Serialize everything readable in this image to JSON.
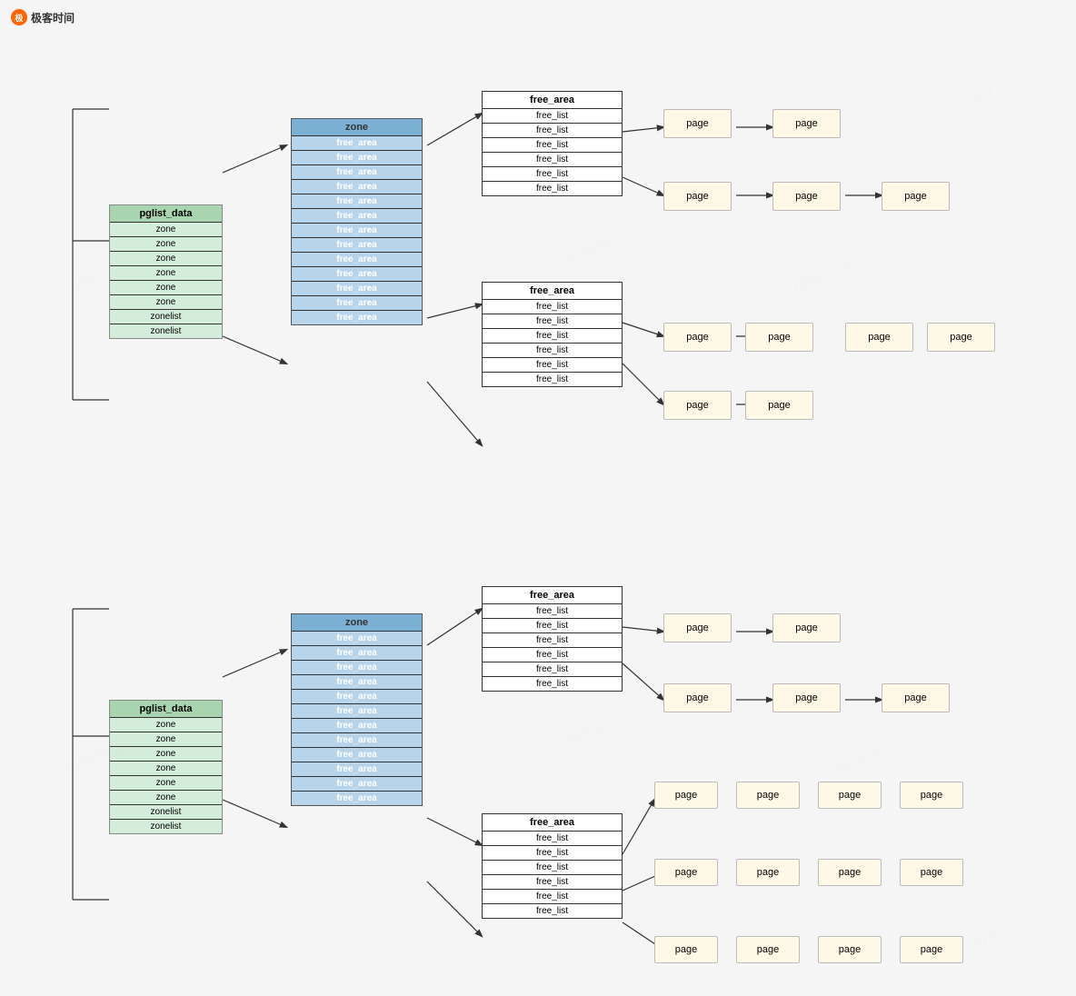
{
  "logo": {
    "icon": "极",
    "text": "极客时间"
  },
  "diagram": {
    "section1": {
      "pglist": {
        "label": "pglist_data",
        "rows": [
          "zone",
          "zone",
          "zone",
          "zone",
          "zone",
          "zone",
          "zonelist",
          "zonelist"
        ]
      },
      "zone": {
        "label": "zone",
        "rows": [
          "free_area",
          "free_area",
          "free_area",
          "free_area",
          "free_area",
          "free_area",
          "free_area",
          "free_area",
          "free_area",
          "free_area",
          "free_area",
          "free_area",
          "free_area"
        ]
      },
      "freeArea1": {
        "label": "free_area",
        "rows": [
          "free_list",
          "free_list",
          "free_list",
          "free_list",
          "free_list",
          "free_list"
        ]
      },
      "freeArea2": {
        "label": "free_area",
        "rows": [
          "free_list",
          "free_list",
          "free_list",
          "free_list",
          "free_list",
          "free_list"
        ]
      }
    },
    "section2": {
      "pglist": {
        "label": "pglist_data",
        "rows": [
          "zone",
          "zone",
          "zone",
          "zone",
          "zone",
          "zone",
          "zonelist",
          "zonelist"
        ]
      },
      "zone": {
        "label": "zone",
        "rows": [
          "free_area",
          "free_area",
          "free_area",
          "free_area",
          "free_area",
          "free_area",
          "free_area",
          "free_area",
          "free_area",
          "free_area",
          "free_area",
          "free_area"
        ]
      },
      "freeArea1": {
        "label": "free_area",
        "rows": [
          "free_list",
          "free_list",
          "free_list",
          "free_list",
          "free_list",
          "free_list"
        ]
      },
      "freeArea2": {
        "label": "free_area",
        "rows": [
          "free_list",
          "free_list",
          "free_list",
          "free_list",
          "free_list",
          "free_list"
        ]
      }
    },
    "pageLabel": "page"
  }
}
